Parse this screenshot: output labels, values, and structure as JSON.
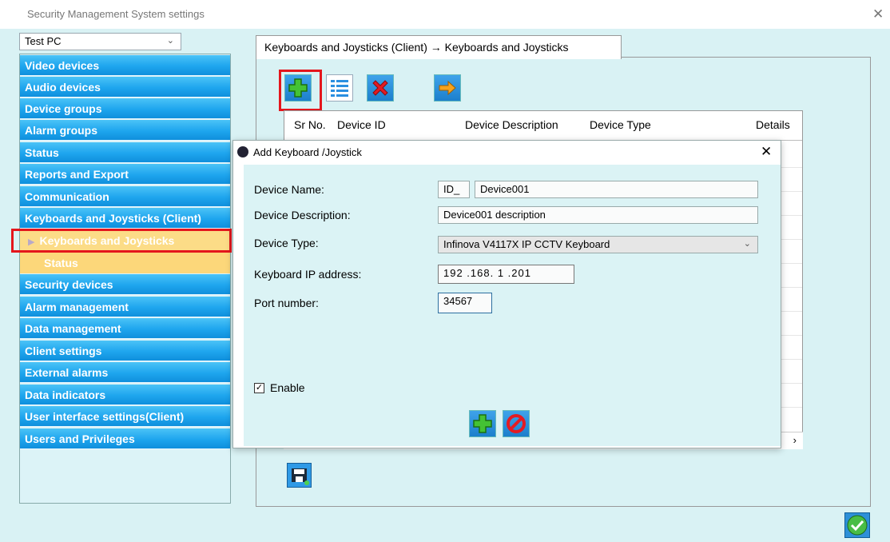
{
  "window": {
    "title": "Security Management System settings",
    "close_glyph": "✕"
  },
  "pc_selector": {
    "value": "Test PC",
    "icon": "chevron-down-icon"
  },
  "nav": {
    "items": [
      {
        "label": "Video devices"
      },
      {
        "label": "Audio devices"
      },
      {
        "label": "Device groups"
      },
      {
        "label": "Alarm groups"
      },
      {
        "label": "Status"
      },
      {
        "label": "Reports and Export"
      },
      {
        "label": "Communication"
      },
      {
        "label": "Keyboards and Joysticks (Client)"
      }
    ],
    "sub_items": [
      {
        "label": "Keyboards and Joysticks",
        "selected": true,
        "icon": "triangle-right-icon"
      },
      {
        "label": "Status",
        "selected": false
      }
    ],
    "items_after": [
      {
        "label": "Security devices"
      },
      {
        "label": "Alarm management"
      },
      {
        "label": "Data management"
      },
      {
        "label": "Client settings"
      },
      {
        "label": "External alarms"
      },
      {
        "label": "Data indicators"
      },
      {
        "label": "User interface settings(Client)"
      },
      {
        "label": "Users and Privileges"
      }
    ]
  },
  "tab": {
    "label": "Keyboards and Joysticks (Client) → Keyboards and Joysticks"
  },
  "toolbar": {
    "add_icon": "add-icon",
    "list_icon": "list-icon",
    "delete_icon": "delete-icon",
    "export_icon": "arrow-right-icon"
  },
  "grid": {
    "columns": [
      "Sr No.",
      "Device ID",
      "Device Description",
      "Device Type",
      "Details"
    ]
  },
  "dialog": {
    "title": "Add Keyboard /Joystick",
    "device_name_label": "Device Name:",
    "device_name_prefix": "ID_",
    "device_name_value": "Device001",
    "device_description_label": "Device Description:",
    "device_description_value": "Device001 description",
    "device_type_label": "Device Type:",
    "device_type_value": "Infinova V4117X IP CCTV Keyboard",
    "ip_label": "Keyboard IP address:",
    "ip_value": "192 .168.  1  .201",
    "port_label": "Port number:",
    "port_value": "34567",
    "enable_label": "Enable",
    "enable_checked": true,
    "enable_check_glyph": "✓",
    "add_icon": "add-icon",
    "cancel_icon": "cancel-icon"
  },
  "colors": {
    "nav_blue": "#1ea5ee",
    "nav_selected": "#fcd77a",
    "highlight_red": "#e4161c",
    "background": "#d9f2f4"
  }
}
